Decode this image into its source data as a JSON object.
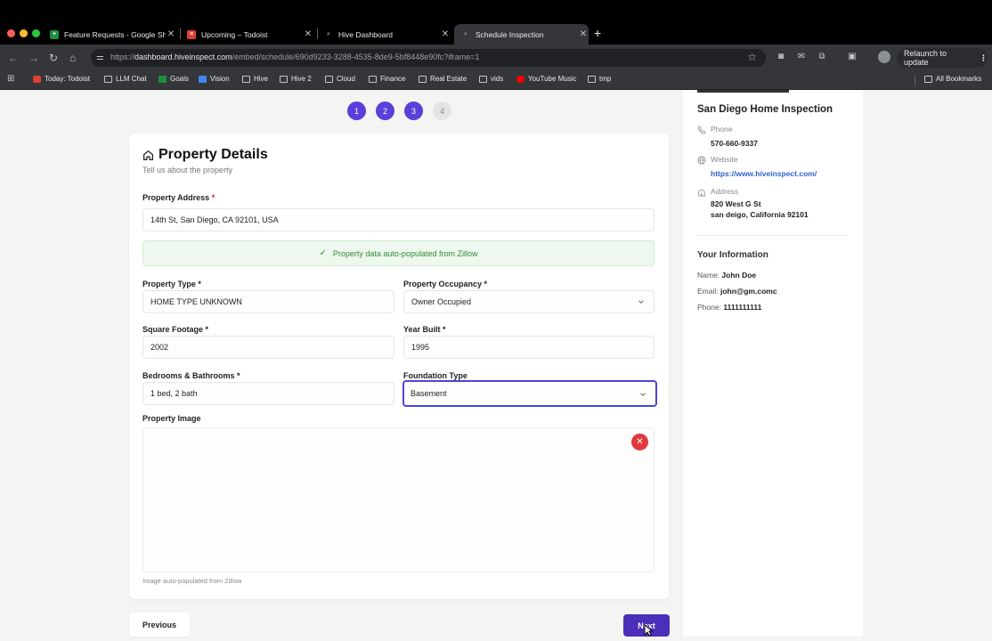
{
  "browser": {
    "tabs": [
      {
        "title": "Feature Requests - Google Sh",
        "favicon": "sheets-icon",
        "color": "#1e8e3e"
      },
      {
        "title": "Upcoming – Todoist",
        "favicon": "todoist-icon",
        "color": "#db4035"
      },
      {
        "title": "Hive Dashboard",
        "favicon": "hive-icon",
        "color": "#8c8f94"
      },
      {
        "title": "Schedule Inspection",
        "favicon": "hive-icon",
        "color": "#8c8f94"
      }
    ],
    "url_prefix": "https://",
    "url_host": "dashboard.hiveinspect.com",
    "url_path": "/embed/schedule/690d9233-3288-4535-8de9-5bf8448e90fc?iframe=1",
    "relaunch_label": "Relaunch to update",
    "bookmarks": [
      {
        "label": "Today: Todoist",
        "icon": "todoist-icon"
      },
      {
        "label": "LLM Chat",
        "icon": "folder-icon"
      },
      {
        "label": "Goals",
        "icon": "sheets-icon"
      },
      {
        "label": "Vision",
        "icon": "docs-icon"
      },
      {
        "label": "Hive",
        "icon": "folder-icon"
      },
      {
        "label": "Hive 2",
        "icon": "folder-icon"
      },
      {
        "label": "Cloud",
        "icon": "folder-icon"
      },
      {
        "label": "Finance",
        "icon": "folder-icon"
      },
      {
        "label": "Real Estate",
        "icon": "folder-icon"
      },
      {
        "label": "vids",
        "icon": "folder-icon"
      },
      {
        "label": "YouTube Music",
        "icon": "youtube-music-icon"
      },
      {
        "label": "tmp",
        "icon": "folder-icon"
      }
    ],
    "all_bookmarks_label": "All Bookmarks"
  },
  "steps": {
    "items": [
      "1",
      "2",
      "3",
      "4"
    ],
    "completed_count": 3
  },
  "form": {
    "title": "Property Details",
    "subtitle": "Tell us about the property",
    "address_label": "Property Address",
    "required_mark": "*",
    "address_value": "14th St, San Diego, CA 92101, USA",
    "banner_text": "Property data auto-populated from Zillow",
    "property_type_label": "Property Type *",
    "property_type_value": "HOME TYPE UNKNOWN",
    "occupancy_label": "Property Occupancy *",
    "occupancy_value": "Owner Occupied",
    "sqft_label": "Square Footage *",
    "sqft_value": "2002",
    "year_built_label": "Year Built *",
    "year_built_value": "1995",
    "bed_bath_label": "Bedrooms & Bathrooms *",
    "bed_bath_value": "1 bed, 2 bath",
    "foundation_label": "Foundation Type",
    "foundation_value": "Basement",
    "image_label": "Property Image",
    "image_hint": "Image auto-populated from Zillow"
  },
  "nav": {
    "previous_label": "Previous",
    "next_label": "Next"
  },
  "company": {
    "name": "San Diego Home Inspection",
    "phone_label": "Phone",
    "phone": "570-660-9337",
    "website_label": "Website",
    "website": "https://www.hiveinspect.com/",
    "address_label": "Address",
    "address_line1": "820 West G St",
    "address_line2": "san deigo, California 92101"
  },
  "user_info": {
    "heading": "Your Information",
    "name_label": "Name:",
    "name": "John Doe",
    "email_label": "Email:",
    "email": "john@gm.comc",
    "phone_label": "Phone:",
    "phone": "1111111111"
  },
  "colors": {
    "accent": "#5b3fd8",
    "next_button": "#4b2fb8",
    "success": "#2f8a3a",
    "danger": "#e03a3e",
    "link": "#2f5fd0"
  }
}
